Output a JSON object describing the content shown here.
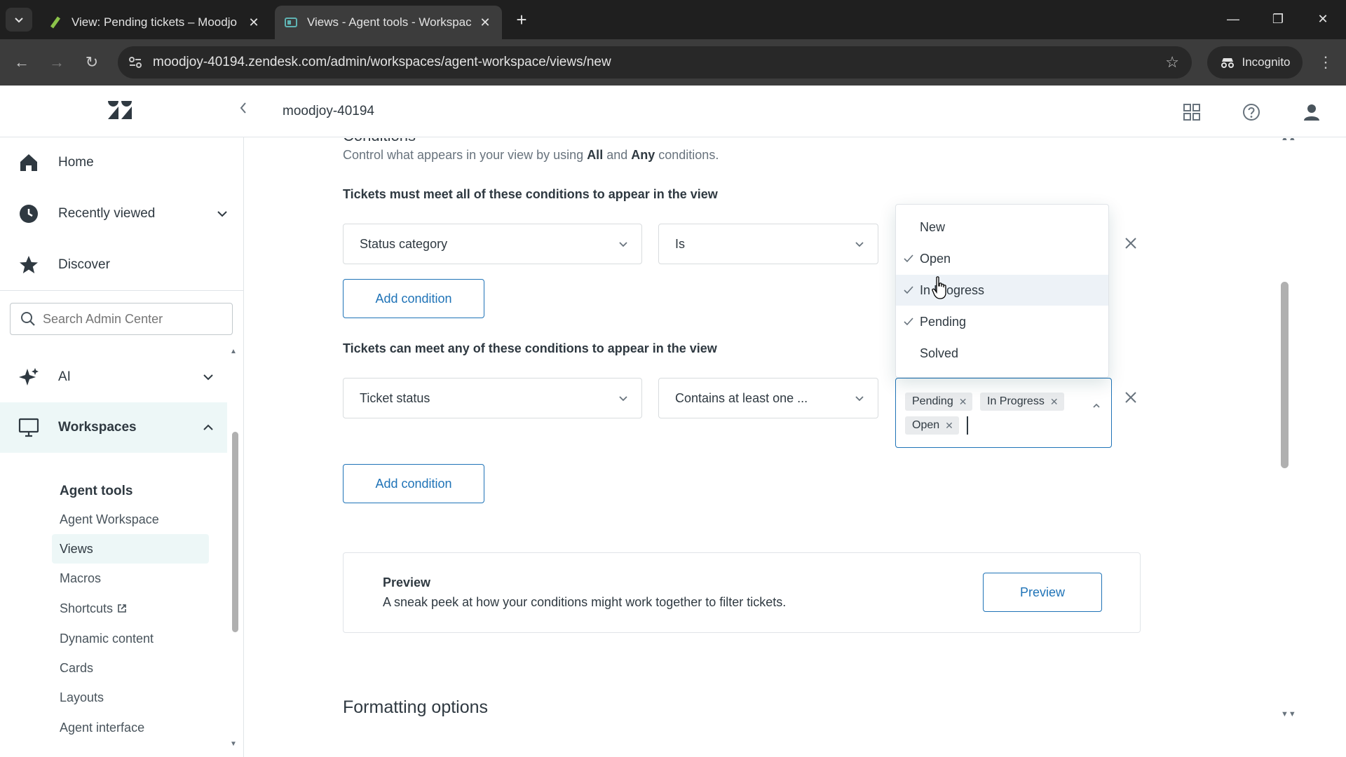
{
  "browser": {
    "tabs": [
      {
        "title": "View: Pending tickets – Moodjo",
        "active": false
      },
      {
        "title": "Views - Agent tools - Workspac",
        "active": true
      }
    ],
    "url": "moodjoy-40194.zendesk.com/admin/workspaces/agent-workspace/views/new",
    "incognito_label": "Incognito"
  },
  "header": {
    "account_name": "moodjoy-40194",
    "icons": [
      "products-grid-icon",
      "help-icon",
      "user-profile-icon"
    ]
  },
  "sidebar": {
    "primary": [
      {
        "label": "Home",
        "icon": "home-icon"
      },
      {
        "label": "Recently viewed",
        "icon": "clock-icon",
        "expandable": true
      },
      {
        "label": "Discover",
        "icon": "star-icon"
      }
    ],
    "search_placeholder": "Search Admin Center",
    "secondary": [
      {
        "label": "AI",
        "icon": "sparkle-icon",
        "expanded": false
      },
      {
        "label": "Workspaces",
        "icon": "monitor-icon",
        "expanded": true
      }
    ],
    "subsection_title": "Agent tools",
    "subitems": [
      "Agent Workspace",
      "Views",
      "Macros",
      "Shortcuts",
      "Dynamic content",
      "Cards",
      "Layouts",
      "Agent interface"
    ],
    "active_subitem": "Views"
  },
  "conditions": {
    "section_title": "Conditions",
    "description_parts": [
      "Control what appears in your view by using ",
      "All",
      " and ",
      "Any",
      " conditions."
    ],
    "all_title": "Tickets must meet all of these conditions to appear in the view",
    "all_row": {
      "field": "Status category",
      "operator": "Is"
    },
    "any_title": "Tickets can meet any of these conditions to appear in the view",
    "any_row": {
      "field": "Ticket status",
      "operator": "Contains at least one ..."
    },
    "selected_values": [
      "Pending",
      "In Progress",
      "Open"
    ],
    "add_condition_label": "Add condition"
  },
  "dropdown": {
    "options": [
      {
        "label": "New",
        "checked": false
      },
      {
        "label": "Open",
        "checked": true
      },
      {
        "label": "In Progress",
        "checked": true,
        "hovered": true
      },
      {
        "label": "Pending",
        "checked": true
      },
      {
        "label": "Solved",
        "checked": false
      }
    ]
  },
  "preview": {
    "title": "Preview",
    "description": "A sneak peek at how your conditions might work together to filter tickets.",
    "button_label": "Preview"
  },
  "formatting": {
    "title": "Formatting options"
  },
  "colors": {
    "accent": "#1f73b7",
    "selected_nav_bg": "#edf7f7",
    "text": "#2f3941",
    "muted": "#68737d"
  }
}
